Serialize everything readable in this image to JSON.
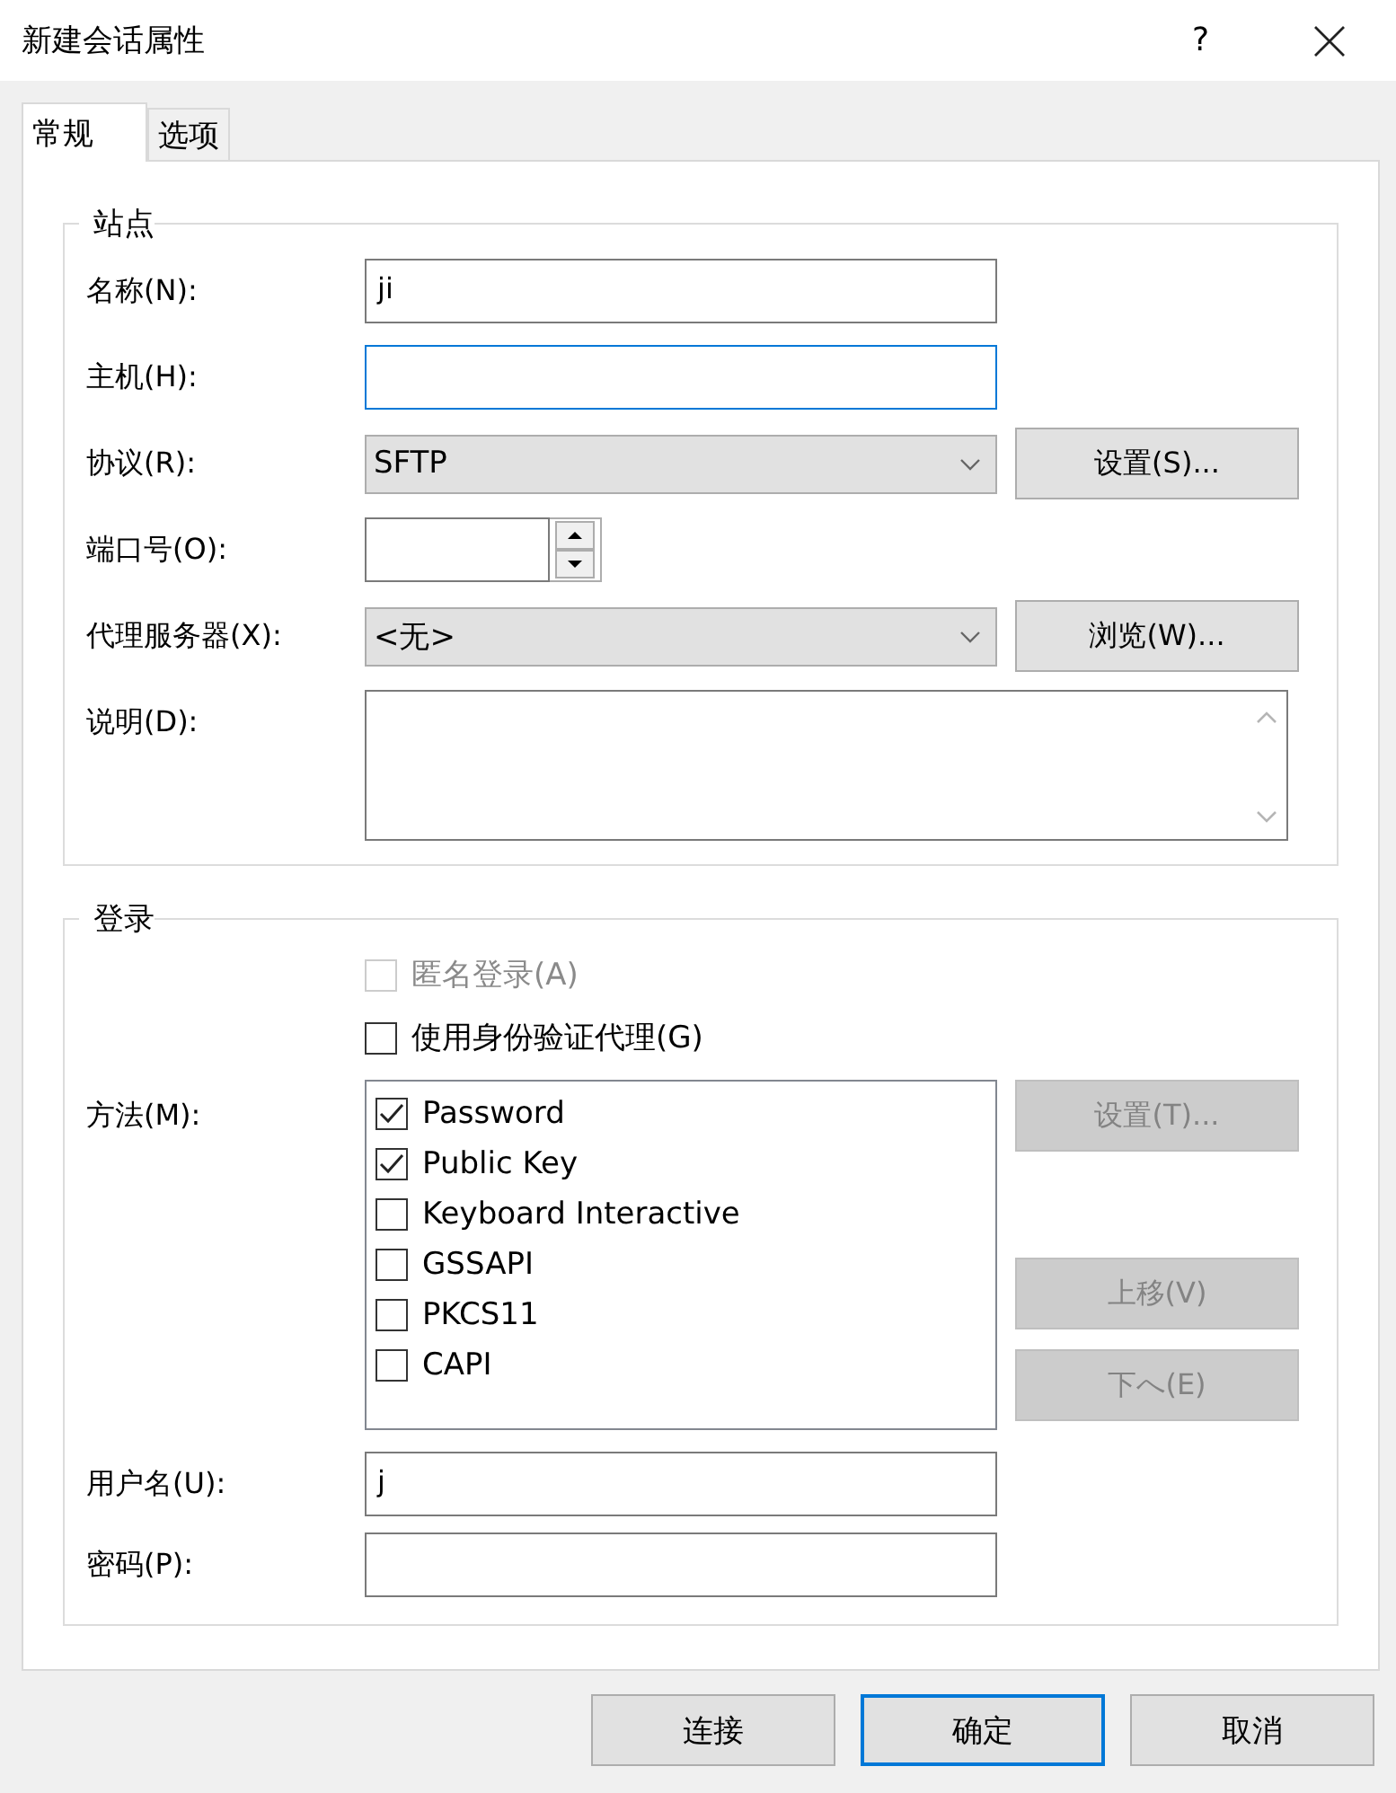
{
  "window": {
    "title": "新建会话属性",
    "help": "?"
  },
  "tabs": [
    {
      "label": "常规",
      "selected": true
    },
    {
      "label": "选项",
      "selected": false
    }
  ],
  "site": {
    "title": "站点",
    "rows": [
      {
        "kind": "text",
        "label": "名称(N):",
        "value": "ji",
        "focused": false
      },
      {
        "kind": "text",
        "label": "主机(H):",
        "focused": true
      },
      {
        "kind": "select",
        "label": "协议(R):",
        "value": "SFTP",
        "button": "设置(S)..."
      },
      {
        "kind": "spin",
        "label": "端口号(O):"
      },
      {
        "kind": "select",
        "label": "代理服务器(X):",
        "value": "<无>",
        "button": "浏览(W)..."
      },
      {
        "kind": "textarea",
        "label": "说明(D):"
      }
    ]
  },
  "login": {
    "title": "登录",
    "options": [
      {
        "label": "匿名登录(A)",
        "checked": false,
        "disabled": true
      },
      {
        "label": "使用身份验证代理(G)",
        "checked": false,
        "disabled": false
      }
    ],
    "method_label": "方法(M):",
    "methods": [
      {
        "label": "Password",
        "checked": true
      },
      {
        "label": "Public Key",
        "checked": true
      },
      {
        "label": "Keyboard Interactive",
        "checked": false
      },
      {
        "label": "GSSAPI",
        "checked": false
      },
      {
        "label": "PKCS11",
        "checked": false
      },
      {
        "label": "CAPI",
        "checked": false
      }
    ],
    "method_buttons": [
      {
        "label": "设置(T)...",
        "disabled": true
      },
      {
        "label": "上移(V)",
        "disabled": true
      },
      {
        "label": "下へ(E)",
        "disabled": true
      }
    ],
    "fields": [
      {
        "label": "用户名(U):",
        "value": "j"
      },
      {
        "label": "密码(P):"
      }
    ]
  },
  "buttons": [
    {
      "label": "连接",
      "default": false
    },
    {
      "label": "确定",
      "default": true
    },
    {
      "label": "取消",
      "default": false
    }
  ]
}
